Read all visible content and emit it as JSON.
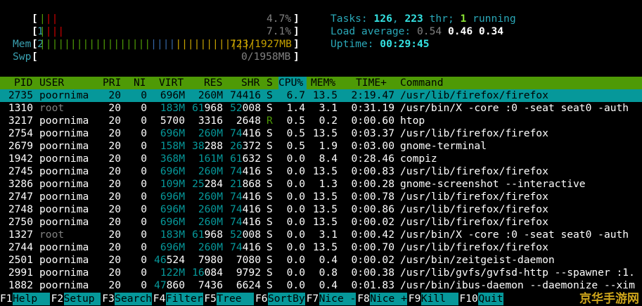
{
  "meters": {
    "cpu1": {
      "label": "1",
      "bar": "|||",
      "bar_colors": [
        "#4e9a06",
        "#cc0000",
        "#cc0000"
      ],
      "value": "4.7%",
      "fill": 0.047
    },
    "cpu2": {
      "label": "2",
      "bar": "||||",
      "bar_colors": [
        "#4e9a06",
        "#cc0000",
        "#cc0000",
        "#cc0000"
      ],
      "value": "7.1%",
      "fill": 0.071
    },
    "mem": {
      "label": "Mem",
      "value": "723/1927MB",
      "used": 723,
      "total": 1927
    },
    "swp": {
      "label": "Swp",
      "value": "0/1958MB",
      "used": 0,
      "total": 1958
    }
  },
  "stats": {
    "tasks_label": "Tasks: ",
    "tasks": "126",
    "sep1": ", ",
    "threads": "223",
    "thr_label": " thr; ",
    "running": "1",
    "running_label": " running",
    "load_label": "Load average: ",
    "load1": "0.54",
    "load5": "0.46",
    "load15": "0.34",
    "uptime_label": "Uptime: ",
    "uptime": "00:29:45"
  },
  "columns": [
    "PID",
    "USER",
    "PRI",
    "NI",
    "VIRT",
    "RES",
    "SHR",
    "S",
    "CPU%",
    "MEM%",
    "TIME+",
    "Command"
  ],
  "sort_column": "CPU%",
  "processes": [
    {
      "pid": "2735",
      "user": "poornima",
      "pri": "20",
      "ni": "0",
      "virt": "696M",
      "res": "260M",
      "shr": "74416",
      "s": "S",
      "cpu": "6.7",
      "mem": "13.5",
      "time": "2:19.47",
      "cmd": "/usr/lib/firefox/firefox"
    },
    {
      "pid": "1310",
      "user": "root",
      "pri": "20",
      "ni": "0",
      "virt": "183M",
      "res": "61968",
      "shr": "52008",
      "s": "S",
      "cpu": "1.4",
      "mem": "3.1",
      "time": "0:31.19",
      "cmd": "/usr/bin/X -core :0 -seat seat0 -auth"
    },
    {
      "pid": "3217",
      "user": "poornima",
      "pri": "20",
      "ni": "0",
      "virt": "5700",
      "res": "3316",
      "shr": "2648",
      "s": "R",
      "cpu": "0.5",
      "mem": "0.2",
      "time": "0:00.60",
      "cmd": "htop"
    },
    {
      "pid": "2754",
      "user": "poornima",
      "pri": "20",
      "ni": "0",
      "virt": "696M",
      "res": "260M",
      "shr": "74416",
      "s": "S",
      "cpu": "0.5",
      "mem": "13.5",
      "time": "0:03.37",
      "cmd": "/usr/lib/firefox/firefox"
    },
    {
      "pid": "2679",
      "user": "poornima",
      "pri": "20",
      "ni": "0",
      "virt": "158M",
      "res": "38288",
      "shr": "26372",
      "s": "S",
      "cpu": "0.5",
      "mem": "1.9",
      "time": "0:03.00",
      "cmd": "gnome-terminal"
    },
    {
      "pid": "1942",
      "user": "poornima",
      "pri": "20",
      "ni": "0",
      "virt": "368M",
      "res": "161M",
      "shr": "61632",
      "s": "S",
      "cpu": "0.0",
      "mem": "8.4",
      "time": "0:28.46",
      "cmd": "compiz"
    },
    {
      "pid": "2745",
      "user": "poornima",
      "pri": "20",
      "ni": "0",
      "virt": "696M",
      "res": "260M",
      "shr": "74416",
      "s": "S",
      "cpu": "0.0",
      "mem": "13.5",
      "time": "0:00.83",
      "cmd": "/usr/lib/firefox/firefox"
    },
    {
      "pid": "3286",
      "user": "poornima",
      "pri": "20",
      "ni": "0",
      "virt": "109M",
      "res": "25284",
      "shr": "21868",
      "s": "S",
      "cpu": "0.0",
      "mem": "1.3",
      "time": "0:00.28",
      "cmd": "gnome-screenshot --interactive"
    },
    {
      "pid": "2747",
      "user": "poornima",
      "pri": "20",
      "ni": "0",
      "virt": "696M",
      "res": "260M",
      "shr": "74416",
      "s": "S",
      "cpu": "0.0",
      "mem": "13.5",
      "time": "0:00.78",
      "cmd": "/usr/lib/firefox/firefox"
    },
    {
      "pid": "2748",
      "user": "poornima",
      "pri": "20",
      "ni": "0",
      "virt": "696M",
      "res": "260M",
      "shr": "74416",
      "s": "S",
      "cpu": "0.0",
      "mem": "13.5",
      "time": "0:00.86",
      "cmd": "/usr/lib/firefox/firefox"
    },
    {
      "pid": "2750",
      "user": "poornima",
      "pri": "20",
      "ni": "0",
      "virt": "696M",
      "res": "260M",
      "shr": "74416",
      "s": "S",
      "cpu": "0.0",
      "mem": "13.5",
      "time": "0:00.02",
      "cmd": "/usr/lib/firefox/firefox"
    },
    {
      "pid": "1327",
      "user": "root",
      "pri": "20",
      "ni": "0",
      "virt": "183M",
      "res": "61968",
      "shr": "52008",
      "s": "S",
      "cpu": "0.0",
      "mem": "3.1",
      "time": "0:00.42",
      "cmd": "/usr/bin/X -core :0 -seat seat0 -auth"
    },
    {
      "pid": "2744",
      "user": "poornima",
      "pri": "20",
      "ni": "0",
      "virt": "696M",
      "res": "260M",
      "shr": "74416",
      "s": "S",
      "cpu": "0.0",
      "mem": "13.5",
      "time": "0:00.70",
      "cmd": "/usr/lib/firefox/firefox"
    },
    {
      "pid": "2501",
      "user": "poornima",
      "pri": "20",
      "ni": "0",
      "virt": "46524",
      "res": "7980",
      "shr": "7080",
      "s": "S",
      "cpu": "0.0",
      "mem": "0.4",
      "time": "0:00.02",
      "cmd": "/usr/bin/zeitgeist-daemon"
    },
    {
      "pid": "2991",
      "user": "poornima",
      "pri": "20",
      "ni": "0",
      "virt": "122M",
      "res": "16084",
      "shr": "9792",
      "s": "S",
      "cpu": "0.0",
      "mem": "0.8",
      "time": "0:00.38",
      "cmd": "/usr/lib/gvfs/gvfsd-http --spawner :1."
    },
    {
      "pid": "1882",
      "user": "poornima",
      "pri": "20",
      "ni": "0",
      "virt": "47860",
      "res": "7436",
      "shr": "6624",
      "s": "S",
      "cpu": "0.0",
      "mem": "0.4",
      "time": "0:01.83",
      "cmd": "/usr/bin/ibus-daemon --daemonize --xim"
    }
  ],
  "selected_row": 0,
  "function_keys": [
    {
      "key": "F1",
      "label": "Help  "
    },
    {
      "key": "F2",
      "label": "Setup "
    },
    {
      "key": "F3",
      "label": "Search"
    },
    {
      "key": "F4",
      "label": "Filter"
    },
    {
      "key": "F5",
      "label": "Tree  "
    },
    {
      "key": "F6",
      "label": "SortBy"
    },
    {
      "key": "F7",
      "label": "Nice -"
    },
    {
      "key": "F8",
      "label": "Nice +"
    },
    {
      "key": "F9",
      "label": "Kill  "
    },
    {
      "key": "F10",
      "label": "Quit"
    }
  ],
  "watermark": "京华手游网",
  "colors": {
    "header_bg": "#4e9a06",
    "selected_bg": "#06989a",
    "label_cyan": "#3aa0b0"
  }
}
